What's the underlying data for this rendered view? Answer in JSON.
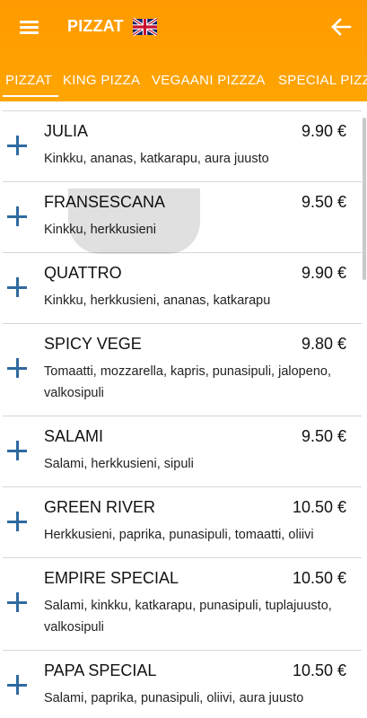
{
  "header": {
    "title": "PIZZAT",
    "language_icon": "uk-flag-icon",
    "menu_icon": "hamburger-menu-icon",
    "back_icon": "arrow-left-icon",
    "bar_color": "#ffa000"
  },
  "tabs": [
    {
      "label": "PIZZAT",
      "active": true
    },
    {
      "label": "KING PIZZA",
      "active": false
    },
    {
      "label": "VEGAANI PIZZZA",
      "active": false
    },
    {
      "label": "SPECIAL PIZZA",
      "active": false
    }
  ],
  "items": [
    {
      "name": "JULIA",
      "price": "9.90 €",
      "desc": "Kinkku, ananas, katkarapu, aura juusto"
    },
    {
      "name": "FRANSESCANA",
      "price": "9.50 €",
      "desc": "Kinkku, herkkusieni"
    },
    {
      "name": "QUATTRO",
      "price": "9.90 €",
      "desc": "Kinkku, herkkusieni, ananas, katkarapu"
    },
    {
      "name": "SPICY VEGE",
      "price": "9.80 €",
      "desc": "Tomaatti, mozzarella, kapris, punasipuli, jalopeno, valkosipuli"
    },
    {
      "name": "SALAMI",
      "price": "9.50 €",
      "desc": "Salami, herkkusieni, sipuli"
    },
    {
      "name": "GREEN RIVER",
      "price": "10.50 €",
      "desc": "Herkkusieni, paprika, punasipuli, tomaatti, oliivi"
    },
    {
      "name": "EMPIRE SPECIAL",
      "price": "10.50 €",
      "desc": "Salami, kinkku, katkarapu, punasipuli, tuplajuusto, valkosipuli"
    },
    {
      "name": "PAPA SPECIAL",
      "price": "10.50 €",
      "desc": "Salami, paprika, punasipuli, oliivi, aura juusto"
    }
  ],
  "accent_color": "#2f6aa0"
}
